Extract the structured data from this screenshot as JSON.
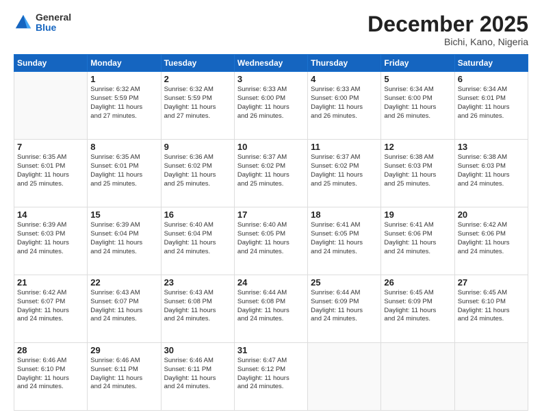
{
  "header": {
    "logo": {
      "general": "General",
      "blue": "Blue"
    },
    "title": "December 2025",
    "location": "Bichi, Kano, Nigeria"
  },
  "weekdays": [
    "Sunday",
    "Monday",
    "Tuesday",
    "Wednesday",
    "Thursday",
    "Friday",
    "Saturday"
  ],
  "weeks": [
    [
      {
        "day": "",
        "info": ""
      },
      {
        "day": "1",
        "info": "Sunrise: 6:32 AM\nSunset: 5:59 PM\nDaylight: 11 hours\nand 27 minutes."
      },
      {
        "day": "2",
        "info": "Sunrise: 6:32 AM\nSunset: 5:59 PM\nDaylight: 11 hours\nand 27 minutes."
      },
      {
        "day": "3",
        "info": "Sunrise: 6:33 AM\nSunset: 6:00 PM\nDaylight: 11 hours\nand 26 minutes."
      },
      {
        "day": "4",
        "info": "Sunrise: 6:33 AM\nSunset: 6:00 PM\nDaylight: 11 hours\nand 26 minutes."
      },
      {
        "day": "5",
        "info": "Sunrise: 6:34 AM\nSunset: 6:00 PM\nDaylight: 11 hours\nand 26 minutes."
      },
      {
        "day": "6",
        "info": "Sunrise: 6:34 AM\nSunset: 6:01 PM\nDaylight: 11 hours\nand 26 minutes."
      }
    ],
    [
      {
        "day": "7",
        "info": "Sunrise: 6:35 AM\nSunset: 6:01 PM\nDaylight: 11 hours\nand 25 minutes."
      },
      {
        "day": "8",
        "info": "Sunrise: 6:35 AM\nSunset: 6:01 PM\nDaylight: 11 hours\nand 25 minutes."
      },
      {
        "day": "9",
        "info": "Sunrise: 6:36 AM\nSunset: 6:02 PM\nDaylight: 11 hours\nand 25 minutes."
      },
      {
        "day": "10",
        "info": "Sunrise: 6:37 AM\nSunset: 6:02 PM\nDaylight: 11 hours\nand 25 minutes."
      },
      {
        "day": "11",
        "info": "Sunrise: 6:37 AM\nSunset: 6:02 PM\nDaylight: 11 hours\nand 25 minutes."
      },
      {
        "day": "12",
        "info": "Sunrise: 6:38 AM\nSunset: 6:03 PM\nDaylight: 11 hours\nand 25 minutes."
      },
      {
        "day": "13",
        "info": "Sunrise: 6:38 AM\nSunset: 6:03 PM\nDaylight: 11 hours\nand 24 minutes."
      }
    ],
    [
      {
        "day": "14",
        "info": "Sunrise: 6:39 AM\nSunset: 6:03 PM\nDaylight: 11 hours\nand 24 minutes."
      },
      {
        "day": "15",
        "info": "Sunrise: 6:39 AM\nSunset: 6:04 PM\nDaylight: 11 hours\nand 24 minutes."
      },
      {
        "day": "16",
        "info": "Sunrise: 6:40 AM\nSunset: 6:04 PM\nDaylight: 11 hours\nand 24 minutes."
      },
      {
        "day": "17",
        "info": "Sunrise: 6:40 AM\nSunset: 6:05 PM\nDaylight: 11 hours\nand 24 minutes."
      },
      {
        "day": "18",
        "info": "Sunrise: 6:41 AM\nSunset: 6:05 PM\nDaylight: 11 hours\nand 24 minutes."
      },
      {
        "day": "19",
        "info": "Sunrise: 6:41 AM\nSunset: 6:06 PM\nDaylight: 11 hours\nand 24 minutes."
      },
      {
        "day": "20",
        "info": "Sunrise: 6:42 AM\nSunset: 6:06 PM\nDaylight: 11 hours\nand 24 minutes."
      }
    ],
    [
      {
        "day": "21",
        "info": "Sunrise: 6:42 AM\nSunset: 6:07 PM\nDaylight: 11 hours\nand 24 minutes."
      },
      {
        "day": "22",
        "info": "Sunrise: 6:43 AM\nSunset: 6:07 PM\nDaylight: 11 hours\nand 24 minutes."
      },
      {
        "day": "23",
        "info": "Sunrise: 6:43 AM\nSunset: 6:08 PM\nDaylight: 11 hours\nand 24 minutes."
      },
      {
        "day": "24",
        "info": "Sunrise: 6:44 AM\nSunset: 6:08 PM\nDaylight: 11 hours\nand 24 minutes."
      },
      {
        "day": "25",
        "info": "Sunrise: 6:44 AM\nSunset: 6:09 PM\nDaylight: 11 hours\nand 24 minutes."
      },
      {
        "day": "26",
        "info": "Sunrise: 6:45 AM\nSunset: 6:09 PM\nDaylight: 11 hours\nand 24 minutes."
      },
      {
        "day": "27",
        "info": "Sunrise: 6:45 AM\nSunset: 6:10 PM\nDaylight: 11 hours\nand 24 minutes."
      }
    ],
    [
      {
        "day": "28",
        "info": "Sunrise: 6:46 AM\nSunset: 6:10 PM\nDaylight: 11 hours\nand 24 minutes."
      },
      {
        "day": "29",
        "info": "Sunrise: 6:46 AM\nSunset: 6:11 PM\nDaylight: 11 hours\nand 24 minutes."
      },
      {
        "day": "30",
        "info": "Sunrise: 6:46 AM\nSunset: 6:11 PM\nDaylight: 11 hours\nand 24 minutes."
      },
      {
        "day": "31",
        "info": "Sunrise: 6:47 AM\nSunset: 6:12 PM\nDaylight: 11 hours\nand 24 minutes."
      },
      {
        "day": "",
        "info": ""
      },
      {
        "day": "",
        "info": ""
      },
      {
        "day": "",
        "info": ""
      }
    ]
  ]
}
